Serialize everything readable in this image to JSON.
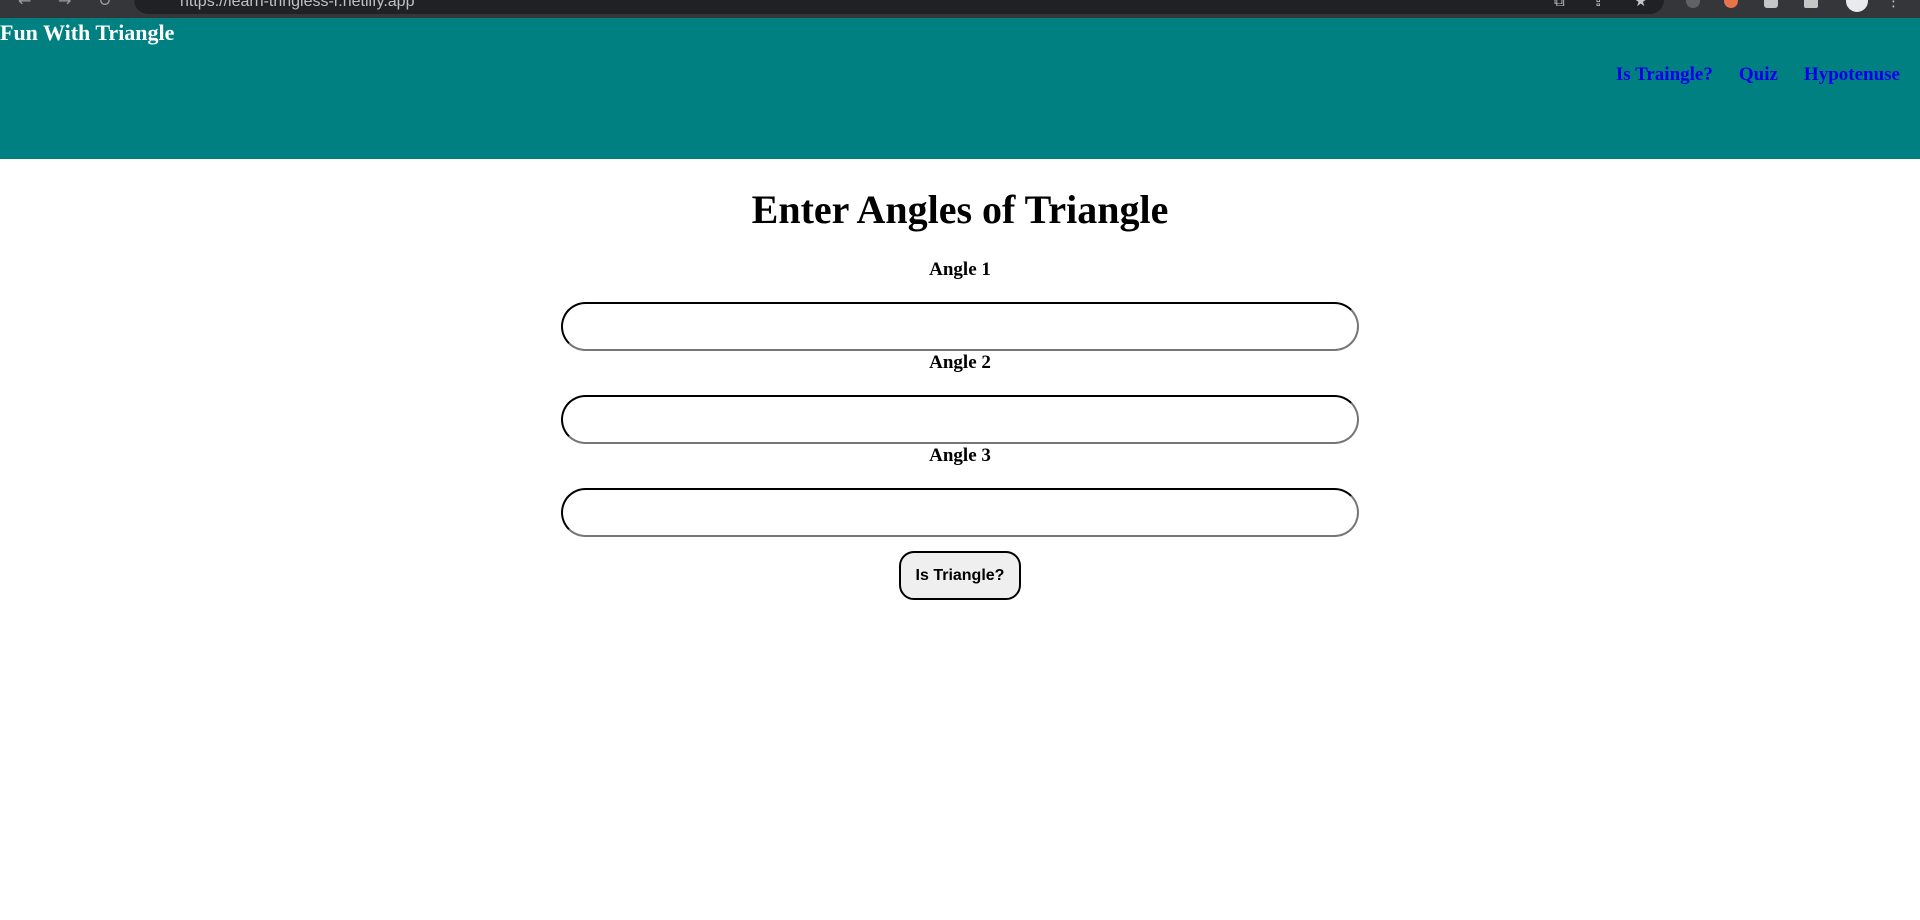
{
  "browser": {
    "url_text": "https://learn-tringless-r.netlify.app",
    "back_glyph": "←",
    "forward_glyph": "→",
    "reload_glyph": "↻",
    "tool_glyphs": [
      "⧉",
      "⇪",
      "★",
      "⋮"
    ],
    "icons": [
      "back-icon",
      "forward-icon",
      "reload-icon",
      "translate-icon",
      "share-icon",
      "bookmark-star-icon",
      "menu-icon"
    ]
  },
  "header": {
    "title": "Fun With Triangle",
    "background_color": "#008080",
    "nav": [
      {
        "label": "Is Traingle?"
      },
      {
        "label": "Quiz"
      },
      {
        "label": "Hypotenuse"
      }
    ],
    "nav_link_color": "#0000ee"
  },
  "form": {
    "heading": "Enter Angles of Triangle",
    "fields": [
      {
        "label": "Angle 1",
        "value": ""
      },
      {
        "label": "Angle 2",
        "value": ""
      },
      {
        "label": "Angle 3",
        "value": ""
      }
    ],
    "submit_label": "Is Triangle?"
  }
}
